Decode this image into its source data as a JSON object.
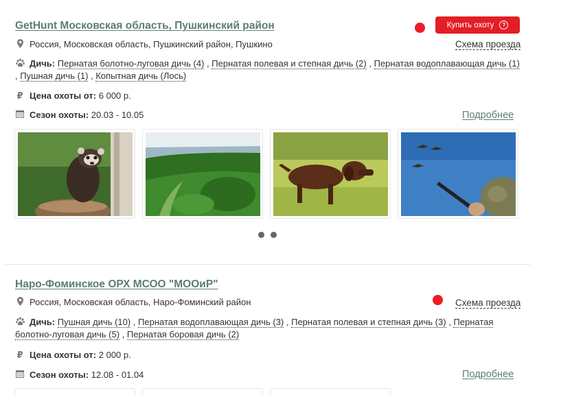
{
  "listings": [
    {
      "title": "GetHunt Московская область, Пушкинский район",
      "address": "Россия, Московская область, Пушкинский район, Пушкино",
      "route_label": "Схема проезда",
      "buy_label": "Купить охоту",
      "game_label": "Дичь:",
      "game": [
        "Пернатая болотно-луговая дичь (4)",
        "Пернатая полевая и степная дичь (2)",
        "Пернатая водоплавающая дичь (1)",
        "Пушная дичь (1)",
        "Копытная дичь (Лось)"
      ],
      "price_label": "Цена охоты от:",
      "price": "6 000 р.",
      "season_label": "Сезон охоты:",
      "season": "20.03 - 10.05",
      "more_label": "Подробнее",
      "photos": [
        "ferret",
        "forest-landscape",
        "hunting-dog",
        "duck-hunter"
      ],
      "carousel_pages": 2
    },
    {
      "title": "Наро-Фоминское ОРХ МСОО \"МООиР\"",
      "address": "Россия, Московская область, Наро-Фоминский район",
      "route_label": "Схема проезда",
      "game_label": "Дичь:",
      "game": [
        "Пушная дичь (10)",
        "Пернатая водоплавающая дичь (3)",
        "Пернатая полевая и степная дичь (3)",
        "Пернатая болотно-луговая дичь (5)",
        "Пернатая боровая дичь (2)"
      ],
      "price_label": "Цена охоты от:",
      "price": "2 000 р.",
      "season_label": "Сезон охоты:",
      "season": "12.08 - 01.04",
      "more_label": "Подробнее"
    }
  ],
  "icons": {
    "location": "map-marker-icon",
    "game": "paw-icon",
    "price": "ruble-icon",
    "season": "calendar-icon",
    "help": "question-circle-icon"
  },
  "colors": {
    "link": "#5a7e74",
    "buy_button": "#e31e24",
    "marker_dot": "#ee1c25"
  }
}
